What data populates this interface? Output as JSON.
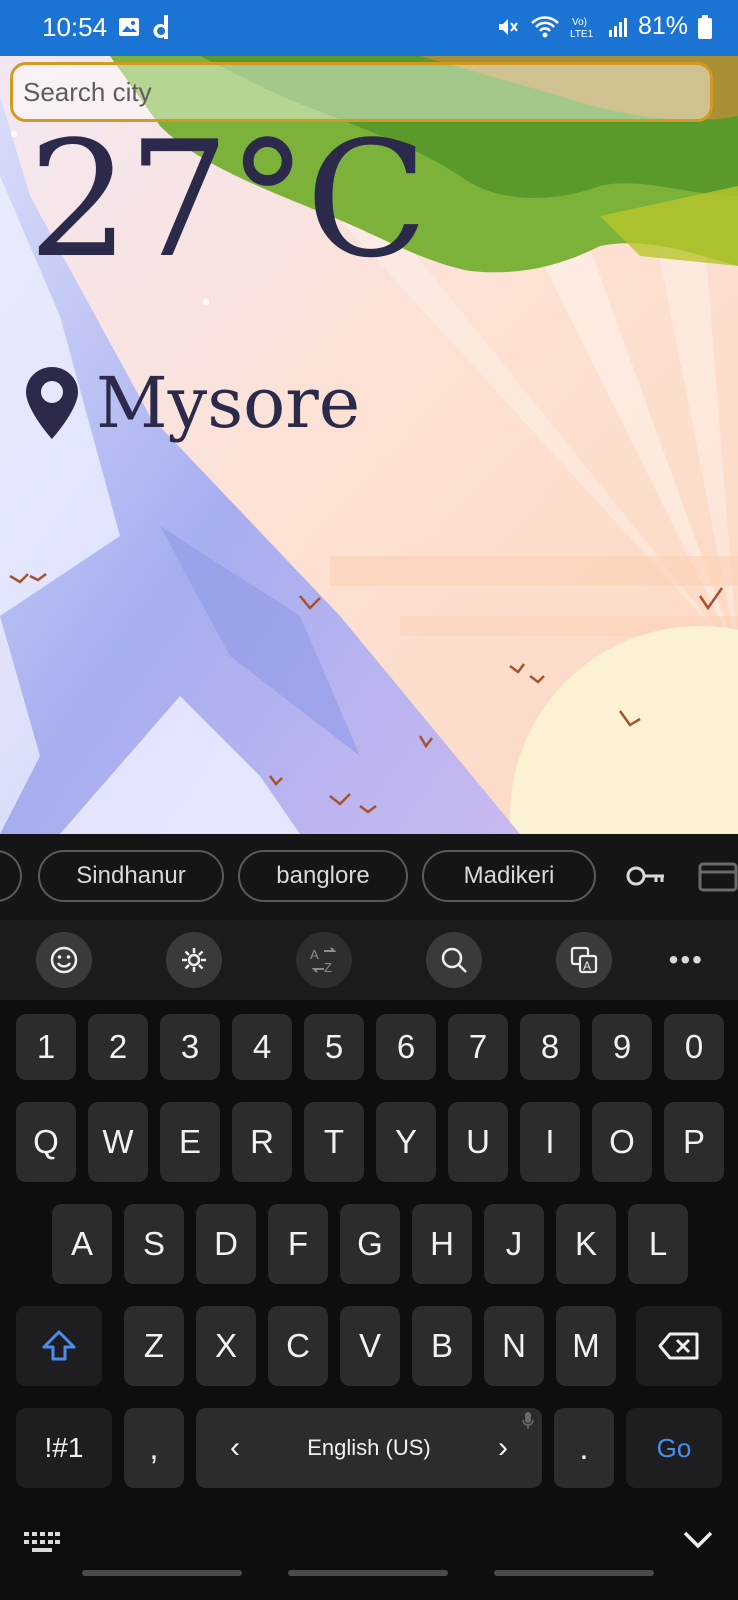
{
  "status_bar": {
    "time": "10:54",
    "battery_percent": "81%",
    "icons": [
      "image-icon",
      "d-app-icon",
      "mute-icon",
      "wifi-icon",
      "volte-icon",
      "signal-icon",
      "battery-icon"
    ]
  },
  "search": {
    "placeholder": "Search city",
    "value": ""
  },
  "weather": {
    "temperature": "27°C",
    "city": "Mysore"
  },
  "keyboard": {
    "suggestions": [
      "Sindhanur",
      "banglore",
      "Madikeri"
    ],
    "toolbar": [
      "emoji-icon",
      "settings-icon",
      "translate-icon",
      "search-icon",
      "text-style-icon",
      "more-icon"
    ],
    "more_label": "•••",
    "row_numbers": [
      "1",
      "2",
      "3",
      "4",
      "5",
      "6",
      "7",
      "8",
      "9",
      "0"
    ],
    "row1": [
      "Q",
      "W",
      "E",
      "R",
      "T",
      "Y",
      "U",
      "I",
      "O",
      "P"
    ],
    "row2": [
      "A",
      "S",
      "D",
      "F",
      "G",
      "H",
      "J",
      "K",
      "L"
    ],
    "row3": [
      "Z",
      "X",
      "C",
      "V",
      "B",
      "N",
      "M"
    ],
    "symbols_label": "!#1",
    "comma": ",",
    "space_label": "English (US)",
    "space_left": "‹",
    "space_right": "›",
    "period": ".",
    "go_label": "Go"
  },
  "colors": {
    "status_bar": "#1b73d3",
    "search_border": "#d39a21",
    "temp_text": "#2c2a4a",
    "go_key": "#4a8df0",
    "shift_key": "#4a8df0"
  }
}
